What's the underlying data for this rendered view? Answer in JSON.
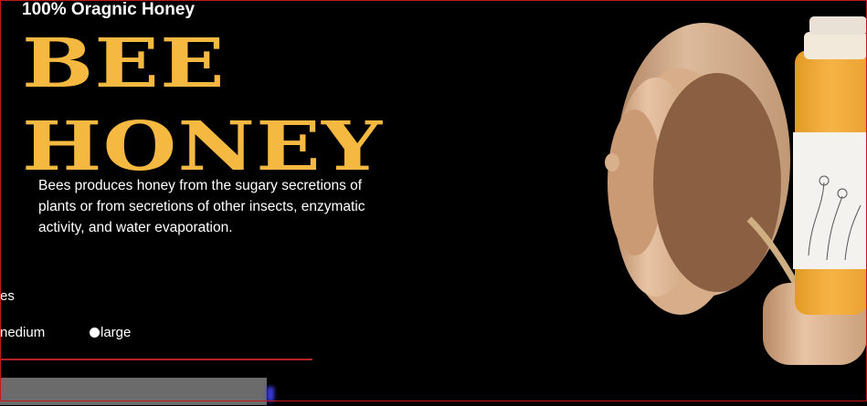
{
  "hero": {
    "tagline": "100% Oragnic Honey",
    "title_line1": "BEE",
    "title_line2": "HONEY",
    "description": "Bees produces honey from the sugary secretions of plants or from secretions of other insects, enzymatic activity, and water evaporation."
  },
  "size_selector": {
    "label": "es",
    "options": [
      {
        "label": "nedium"
      },
      {
        "label": "large"
      }
    ]
  },
  "colors": {
    "background": "#000000",
    "accent": "#f5b841",
    "divider": "#b22222"
  },
  "product_image": {
    "icon": "honey-jar-wooden-hive-image"
  }
}
